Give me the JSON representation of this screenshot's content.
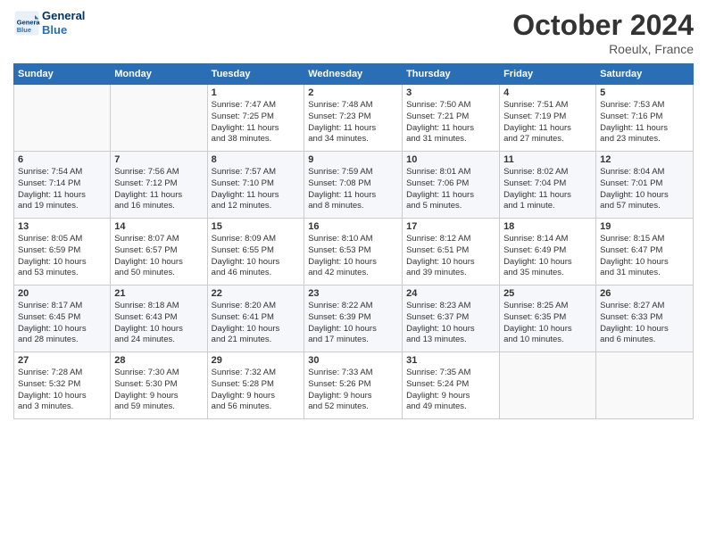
{
  "header": {
    "logo_line1": "General",
    "logo_line2": "Blue",
    "month": "October 2024",
    "location": "Roeulx, France"
  },
  "days_of_week": [
    "Sunday",
    "Monday",
    "Tuesday",
    "Wednesday",
    "Thursday",
    "Friday",
    "Saturday"
  ],
  "weeks": [
    [
      {
        "num": "",
        "info": ""
      },
      {
        "num": "",
        "info": ""
      },
      {
        "num": "1",
        "info": "Sunrise: 7:47 AM\nSunset: 7:25 PM\nDaylight: 11 hours\nand 38 minutes."
      },
      {
        "num": "2",
        "info": "Sunrise: 7:48 AM\nSunset: 7:23 PM\nDaylight: 11 hours\nand 34 minutes."
      },
      {
        "num": "3",
        "info": "Sunrise: 7:50 AM\nSunset: 7:21 PM\nDaylight: 11 hours\nand 31 minutes."
      },
      {
        "num": "4",
        "info": "Sunrise: 7:51 AM\nSunset: 7:19 PM\nDaylight: 11 hours\nand 27 minutes."
      },
      {
        "num": "5",
        "info": "Sunrise: 7:53 AM\nSunset: 7:16 PM\nDaylight: 11 hours\nand 23 minutes."
      }
    ],
    [
      {
        "num": "6",
        "info": "Sunrise: 7:54 AM\nSunset: 7:14 PM\nDaylight: 11 hours\nand 19 minutes."
      },
      {
        "num": "7",
        "info": "Sunrise: 7:56 AM\nSunset: 7:12 PM\nDaylight: 11 hours\nand 16 minutes."
      },
      {
        "num": "8",
        "info": "Sunrise: 7:57 AM\nSunset: 7:10 PM\nDaylight: 11 hours\nand 12 minutes."
      },
      {
        "num": "9",
        "info": "Sunrise: 7:59 AM\nSunset: 7:08 PM\nDaylight: 11 hours\nand 8 minutes."
      },
      {
        "num": "10",
        "info": "Sunrise: 8:01 AM\nSunset: 7:06 PM\nDaylight: 11 hours\nand 5 minutes."
      },
      {
        "num": "11",
        "info": "Sunrise: 8:02 AM\nSunset: 7:04 PM\nDaylight: 11 hours\nand 1 minute."
      },
      {
        "num": "12",
        "info": "Sunrise: 8:04 AM\nSunset: 7:01 PM\nDaylight: 10 hours\nand 57 minutes."
      }
    ],
    [
      {
        "num": "13",
        "info": "Sunrise: 8:05 AM\nSunset: 6:59 PM\nDaylight: 10 hours\nand 53 minutes."
      },
      {
        "num": "14",
        "info": "Sunrise: 8:07 AM\nSunset: 6:57 PM\nDaylight: 10 hours\nand 50 minutes."
      },
      {
        "num": "15",
        "info": "Sunrise: 8:09 AM\nSunset: 6:55 PM\nDaylight: 10 hours\nand 46 minutes."
      },
      {
        "num": "16",
        "info": "Sunrise: 8:10 AM\nSunset: 6:53 PM\nDaylight: 10 hours\nand 42 minutes."
      },
      {
        "num": "17",
        "info": "Sunrise: 8:12 AM\nSunset: 6:51 PM\nDaylight: 10 hours\nand 39 minutes."
      },
      {
        "num": "18",
        "info": "Sunrise: 8:14 AM\nSunset: 6:49 PM\nDaylight: 10 hours\nand 35 minutes."
      },
      {
        "num": "19",
        "info": "Sunrise: 8:15 AM\nSunset: 6:47 PM\nDaylight: 10 hours\nand 31 minutes."
      }
    ],
    [
      {
        "num": "20",
        "info": "Sunrise: 8:17 AM\nSunset: 6:45 PM\nDaylight: 10 hours\nand 28 minutes."
      },
      {
        "num": "21",
        "info": "Sunrise: 8:18 AM\nSunset: 6:43 PM\nDaylight: 10 hours\nand 24 minutes."
      },
      {
        "num": "22",
        "info": "Sunrise: 8:20 AM\nSunset: 6:41 PM\nDaylight: 10 hours\nand 21 minutes."
      },
      {
        "num": "23",
        "info": "Sunrise: 8:22 AM\nSunset: 6:39 PM\nDaylight: 10 hours\nand 17 minutes."
      },
      {
        "num": "24",
        "info": "Sunrise: 8:23 AM\nSunset: 6:37 PM\nDaylight: 10 hours\nand 13 minutes."
      },
      {
        "num": "25",
        "info": "Sunrise: 8:25 AM\nSunset: 6:35 PM\nDaylight: 10 hours\nand 10 minutes."
      },
      {
        "num": "26",
        "info": "Sunrise: 8:27 AM\nSunset: 6:33 PM\nDaylight: 10 hours\nand 6 minutes."
      }
    ],
    [
      {
        "num": "27",
        "info": "Sunrise: 7:28 AM\nSunset: 5:32 PM\nDaylight: 10 hours\nand 3 minutes."
      },
      {
        "num": "28",
        "info": "Sunrise: 7:30 AM\nSunset: 5:30 PM\nDaylight: 9 hours\nand 59 minutes."
      },
      {
        "num": "29",
        "info": "Sunrise: 7:32 AM\nSunset: 5:28 PM\nDaylight: 9 hours\nand 56 minutes."
      },
      {
        "num": "30",
        "info": "Sunrise: 7:33 AM\nSunset: 5:26 PM\nDaylight: 9 hours\nand 52 minutes."
      },
      {
        "num": "31",
        "info": "Sunrise: 7:35 AM\nSunset: 5:24 PM\nDaylight: 9 hours\nand 49 minutes."
      },
      {
        "num": "",
        "info": ""
      },
      {
        "num": "",
        "info": ""
      }
    ]
  ]
}
